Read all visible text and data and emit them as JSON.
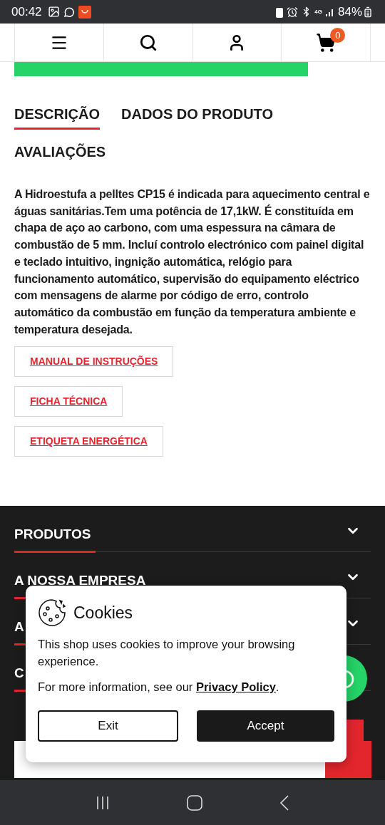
{
  "status_bar": {
    "time": "00:42",
    "network": "4G",
    "battery": "84%"
  },
  "nav": {
    "cart_count": "0"
  },
  "tabs": [
    {
      "label": "DESCRIÇÃO",
      "selected": true
    },
    {
      "label": "DADOS DO PRODUTO",
      "selected": false
    },
    {
      "label": "AVALIAÇÕES",
      "selected": false
    }
  ],
  "description": "A Hidroestufa a pelltes  CP15 é indicada para aquecimento central e águas sanitárias.Tem uma potência de 17,1kW. É constituída em chapa de aço ao carbono, com uma espessura na câmara de combustão de 5 mm. Incluí controlo electrónico com painel digital e teclado intuitivo, ingnição automática, relógio para funcionamento automático, supervisão do equipamento eléctrico com mensagens de alarme por código de erro, controlo automático da combustão em função da temperatura ambiente e temperatura desejada.",
  "documents": [
    "MANUAL DE INSTRUÇÕES",
    "FICHA TÉCNICA",
    "ETIQUETA ENERGÉTICA"
  ],
  "footer_sections": [
    {
      "title": "PRODUTOS",
      "chevron": true
    },
    {
      "title": "A NOSSA EMPRESA",
      "chevron": true
    },
    {
      "title": "A",
      "chevron": true
    },
    {
      "title": "C"
    }
  ],
  "cookie_dialog": {
    "title": "Cookies",
    "text": "This shop uses cookies to improve your browsing experience.",
    "more_info": "For more information, see our ",
    "link": "Privacy Policy",
    "after_link": ".",
    "buttons": [
      {
        "label": "Exit",
        "kind": "secondary"
      },
      {
        "label": "Accept",
        "kind": "primary"
      }
    ]
  }
}
